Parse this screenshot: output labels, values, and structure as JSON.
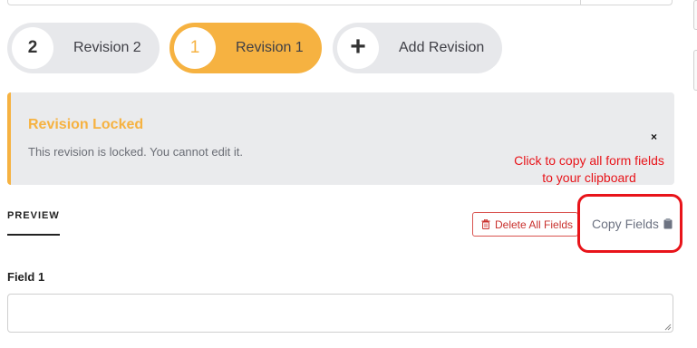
{
  "revisions": [
    {
      "number": "2",
      "label": "Revision 2",
      "active": false
    },
    {
      "number": "1",
      "label": "Revision 1",
      "active": true
    }
  ],
  "add_revision": {
    "label": "Add Revision",
    "icon": "plus-icon"
  },
  "alert": {
    "title": "Revision Locked",
    "message": "This revision is locked. You cannot edit it.",
    "close": "×"
  },
  "annotation": {
    "line1": "Click to copy all form fields",
    "line2": "to your clipboard"
  },
  "preview_tab": {
    "label": "PREVIEW"
  },
  "toolbar": {
    "delete_label": "Delete All Fields",
    "delete_icon": "trash-icon",
    "copy_label": "Copy Fields",
    "copy_icon": "clipboard-icon"
  },
  "field1": {
    "label": "Field 1",
    "value": ""
  },
  "colors": {
    "accent": "#f6b241",
    "danger": "#d9534f",
    "annotation": "#e8141a",
    "pill_bg": "#e7e8eb",
    "alert_bg": "#eaebed"
  }
}
